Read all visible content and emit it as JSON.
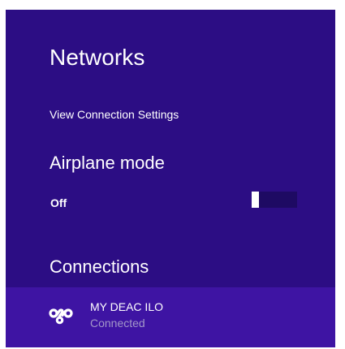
{
  "panel": {
    "title": "Networks",
    "view_settings_link": "View Connection Settings"
  },
  "airplane_mode": {
    "label": "Airplane mode",
    "state_text": "Off",
    "on": false
  },
  "connections": {
    "heading": "Connections",
    "items": [
      {
        "name": "MY DEAC ILO",
        "status": "Connected",
        "icon": "network-link-icon"
      }
    ]
  },
  "colors": {
    "panel_background": "#2c0d84",
    "selected_row_background": "#3e14a3",
    "toggle_track": "#1e0a63",
    "toggle_thumb": "#ffffff",
    "secondary_text": "#a397c9"
  }
}
